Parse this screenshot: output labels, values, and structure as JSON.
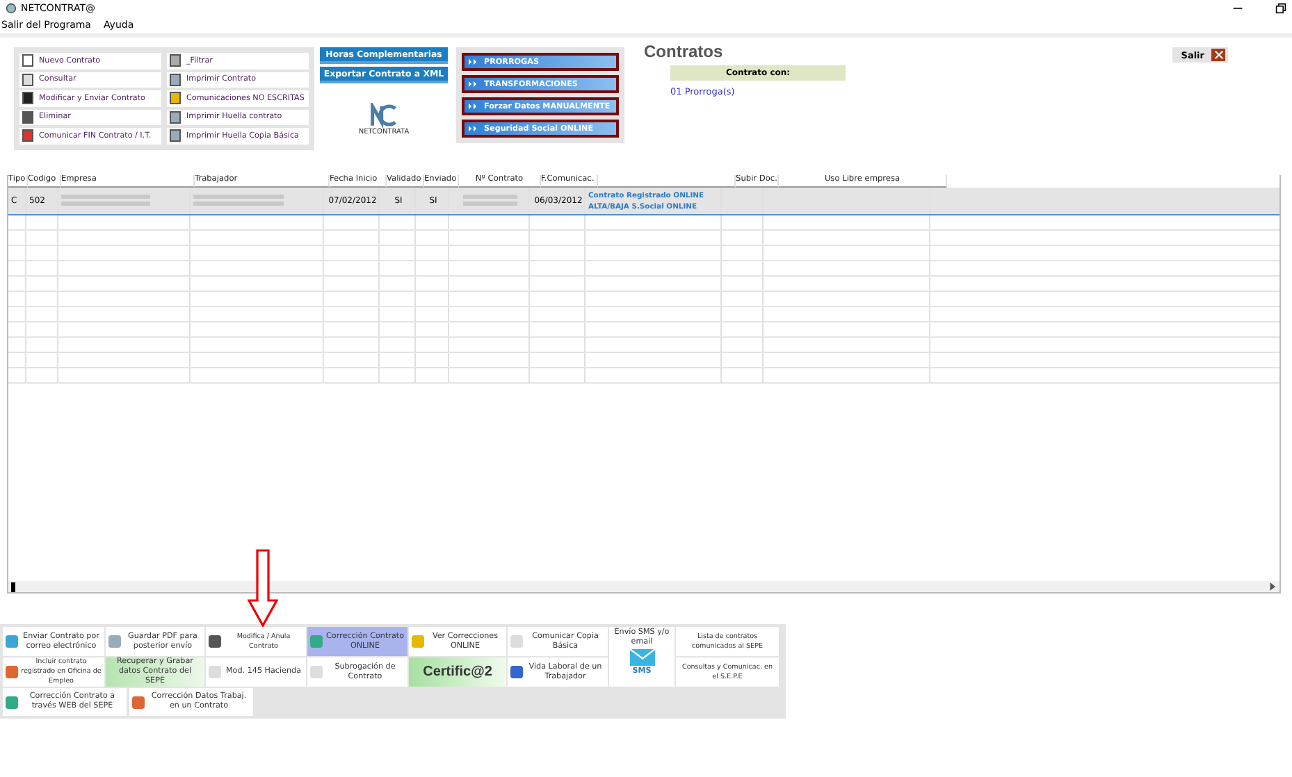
{
  "window": {
    "title": "NETCONTRAT@"
  },
  "menu": [
    "Salir del Programa",
    "Ayuda"
  ],
  "actions_left": [
    "Nuevo Contrato",
    "Consultar",
    "Modificar y Enviar Contrato",
    "Eliminar",
    "Comunicar FIN Contrato / I.T."
  ],
  "actions_middle": [
    "_Filtrar",
    "Imprimir Contrato",
    "Comunicaciones NO ESCRITAS",
    "Imprimir Huella contrato",
    "Imprimir Huella Copia Básica"
  ],
  "blue_buttons": [
    "Horas Complementarias",
    "Exportar Contrato a XML"
  ],
  "logo_text": "NETCONTRATA",
  "special_buttons": [
    "PRORROGAS",
    "TRANSFORMACIONES",
    "Forzar Datos MANUALMENTE",
    "Seguridad Social ONLINE"
  ],
  "contracts": {
    "title": "Contratos",
    "header": "Contrato con:",
    "links": [
      "01 Prorroga(s)"
    ]
  },
  "exit_button": "Salir",
  "table": {
    "columns": [
      "Tipo",
      "Codigo",
      "Empresa",
      "Trabajador",
      "Fecha Inicio",
      "Validado",
      "Enviado",
      "Nº Contrato",
      "F.Comunicac.",
      "",
      "Subir Doc.",
      "Uso Libre empresa"
    ],
    "rows": [
      {
        "selected": true,
        "cells": [
          "C",
          "502",
          "",
          "",
          "07/02/2012",
          "SI",
          "SI",
          "",
          "06/03/2012"
        ],
        "status": [
          "Contrato Registrado ONLINE",
          "ALTA/BAJA S.Social ONLINE"
        ]
      }
    ]
  },
  "bottom_buttons": [
    {
      "label": "Enviar Contrato por correo electrónico",
      "kind": "normal"
    },
    {
      "label": "Guardar PDF para posterior envío",
      "kind": "normal"
    },
    {
      "label": "Modifica / Anula Contrato",
      "kind": "small"
    },
    {
      "label": "Corrección Contrato ONLINE",
      "kind": "highlight"
    },
    {
      "label": "Ver Correcciones ONLINE",
      "kind": "normal"
    },
    {
      "label": "Comunicar Copia Básica",
      "kind": "normal"
    },
    {
      "label": "Envío SMS y/o email",
      "kind": "sms",
      "caption": "SMS"
    },
    {
      "label": "Lista de contratos comunicados al SEPE",
      "kind": "small"
    },
    {
      "label": "Incluir contrato registrado en Oficina de Empleo",
      "kind": "small"
    },
    {
      "label": "Recuperar y Grabar datos Contrato del SEPE",
      "kind": "green"
    },
    {
      "label": "Mod. 145 Hacienda",
      "kind": "normal"
    },
    {
      "label": "Subrogación de Contrato",
      "kind": "normal"
    },
    {
      "label": "Certific@2",
      "kind": "big"
    },
    {
      "label": "Vida Laboral de un Trabajador",
      "kind": "normal"
    },
    {
      "label": "Consultas y Comunicac. en el S.E.P.E",
      "kind": "small"
    }
  ],
  "bottom_extra": [
    "Corrección Contrato a través WEB del SEPE",
    "Corrección Datos Trabaj. en un Contrato"
  ]
}
